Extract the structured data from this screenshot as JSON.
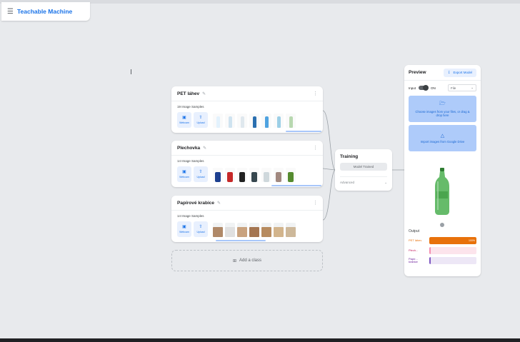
{
  "app": {
    "title": "Teachable Machine",
    "menu_icon": "hamburger-menu-icon"
  },
  "classes": [
    {
      "name": "PET láhev",
      "samples_label": "19 Image Samples",
      "webcam_label": "Webcam",
      "upload_label": "Upload",
      "thumb_kind": "bottle",
      "thumb_colors": [
        "#e3f2fd",
        "#cfe3f0",
        "#dfe8ee",
        "#2a6fb0",
        "#4fa3e0",
        "#9ccfe6",
        "#b8d8b0"
      ]
    },
    {
      "name": "Plechovka",
      "samples_label": "14 Image Samples",
      "webcam_label": "Webcam",
      "upload_label": "Upload",
      "thumb_kind": "can",
      "thumb_colors": [
        "#1d3f8f",
        "#c62828",
        "#212121",
        "#37474f",
        "#cfd8dc",
        "#a1887f",
        "#558b2f"
      ]
    },
    {
      "name": "Papírové krabice",
      "samples_label": "14 Image Samples",
      "webcam_label": "Webcam",
      "upload_label": "Upload",
      "thumb_kind": "box",
      "thumb_colors": [
        "#b08968",
        "#e0e0e0",
        "#c9a27e",
        "#a47551",
        "#b78b5f",
        "#d2b48c",
        "#cdb89a"
      ]
    }
  ],
  "add_class_label": "Add a class",
  "training": {
    "title": "Training",
    "button_label": "Model Trained",
    "advanced_label": "Advanced"
  },
  "preview": {
    "title": "Preview",
    "export_label": "Export Model",
    "input_label": "Input",
    "toggle_label": "ON",
    "source_value": "File",
    "drop_files_text": "Choose images from your files, or drag & drop here",
    "drive_text": "Import images from Google Drive",
    "output_title": "Output",
    "outputs": [
      {
        "label": "PET láhev",
        "value": 100,
        "value_label": "100%",
        "color": "#e8710a",
        "track": "#fde7d3",
        "text_color": "#e8710a"
      },
      {
        "label": "Plech...",
        "value": 0,
        "value_label": "",
        "color": "#f48fb1",
        "track": "#fce4ec",
        "text_color": "#c2185b"
      },
      {
        "label": "Papír... krabice",
        "value": 0,
        "value_label": "",
        "color": "#7e57c2",
        "track": "#ede7f6",
        "text_color": "#6a1b9a"
      }
    ]
  }
}
